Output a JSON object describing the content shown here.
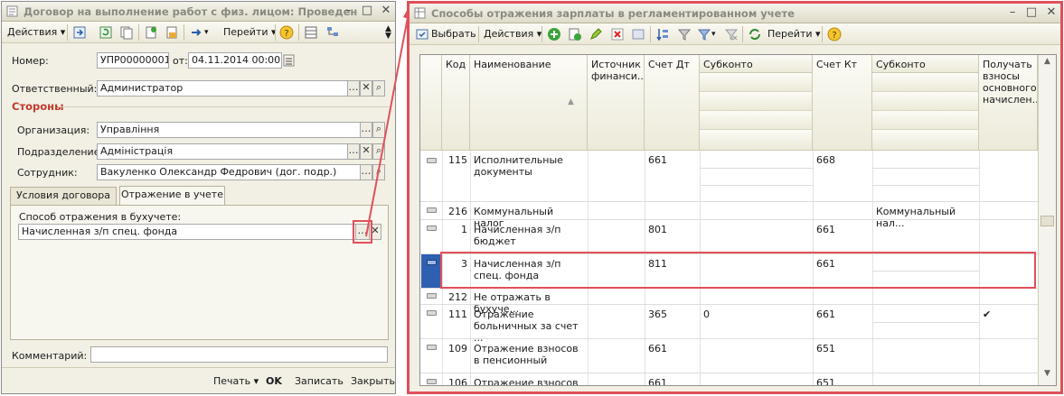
{
  "left_window": {
    "title": "Договор на выполнение работ с физ. лицом: Проведен",
    "toolbar": {
      "actions": "Действия",
      "goto": "Перейти"
    },
    "number_label": "Номер:",
    "number_value": "УПР00000001",
    "date_label": "от:",
    "date_value": "04.11.2014 00:00:00",
    "responsible_label": "Ответственный:",
    "responsible_value": "Администратор",
    "parties_header": "Стороны",
    "org_label": "Организация:",
    "org_value": "Управління",
    "dept_label": "Подразделение:",
    "dept_value": "Адміністрація",
    "employee_label": "Сотрудник:",
    "employee_value": "Вакуленко Олександр Федрович (дог. подр.)",
    "tabs": [
      "Условия договора",
      "Отражение в учете"
    ],
    "method_label": "Способ отражения в бухучете:",
    "method_value": "Начисленная з/п спец. фонда",
    "comment_label": "Комментарий:",
    "bottom": {
      "print": "Печать",
      "ok": "OK",
      "save": "Записать",
      "close": "Закрыть"
    }
  },
  "right_window": {
    "title": "Способы отражения зарплаты в регламентированном учете",
    "toolbar": {
      "select": "Выбрать",
      "actions": "Действия",
      "goto": "Перейти"
    },
    "columns": {
      "code": "Код",
      "name": "Наименование",
      "source": "Источник финанси...",
      "debit": "Счет Дт",
      "subconto1": "Субконто",
      "credit": "Счет Кт",
      "subconto2": "Субконто",
      "contrib": "Получать взносы основного начислен..."
    },
    "rows": [
      {
        "code": "115",
        "name": "Исполнительные документы",
        "source": "",
        "debit": "661",
        "sub1": "",
        "credit": "668",
        "sub2": "",
        "contrib": ""
      },
      {
        "code": "216",
        "name": "Коммунальный налог",
        "source": "",
        "debit": "",
        "sub1": "",
        "credit": "",
        "sub2": "Коммунальный нал...",
        "contrib": ""
      },
      {
        "code": "1",
        "name": "Начисленная з/п бюджет",
        "source": "",
        "debit": "801",
        "sub1": "",
        "credit": "661",
        "sub2": "",
        "contrib": ""
      },
      {
        "code": "3",
        "name": "Начисленная з/п спец. фонда",
        "source": "",
        "debit": "811",
        "sub1": "",
        "credit": "661",
        "sub2": "",
        "contrib": ""
      },
      {
        "code": "212",
        "name": "Не отражать в бухуче...",
        "source": "",
        "debit": "",
        "sub1": "",
        "credit": "",
        "sub2": "",
        "contrib": ""
      },
      {
        "code": "111",
        "name": "Отражение больничных за счет ...",
        "source": "",
        "debit": "365",
        "sub1": "0",
        "credit": "661",
        "sub2": "",
        "contrib": "✔"
      },
      {
        "code": "109",
        "name": "Отражение взносов в пенсионный",
        "source": "",
        "debit": "661",
        "sub1": "",
        "credit": "651",
        "sub2": "",
        "contrib": ""
      },
      {
        "code": "106",
        "name": "Отражение взносов в",
        "source": "",
        "debit": "661",
        "sub1": "",
        "credit": "651",
        "sub2": "",
        "contrib": ""
      }
    ]
  },
  "colors": {
    "highlight": "#e0505a",
    "section": "#c0392b"
  }
}
